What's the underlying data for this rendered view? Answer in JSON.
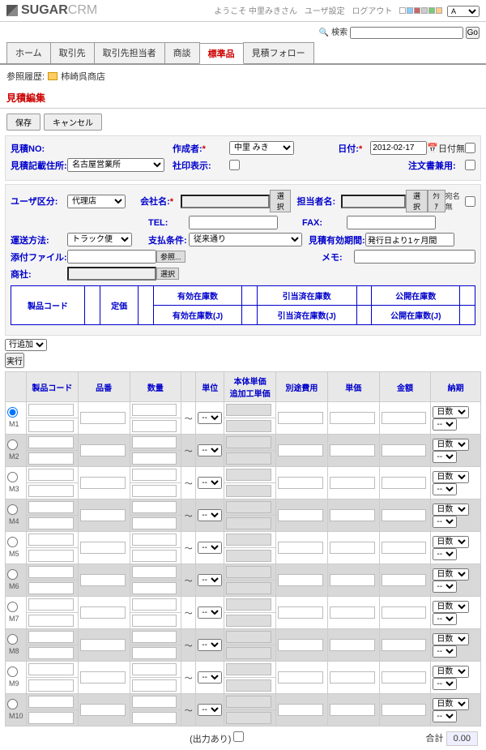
{
  "header": {
    "logo_main": "SUGAR",
    "logo_sub": "CRM",
    "welcome": "ようこそ 中里みきさん",
    "links": [
      "ユーザ設定",
      "ログアウト"
    ],
    "search_label": "検索",
    "search_btn": "Go"
  },
  "tabs": [
    "ホーム",
    "取引先",
    "取引先担当者",
    "商談",
    "標準品",
    "見積フォロー"
  ],
  "active_tab": "標準品",
  "breadcrumb": {
    "label": "参照履歴:",
    "item": "柿崎呉商店"
  },
  "page_title": "見積編集",
  "buttons": {
    "save": "保存",
    "cancel": "キャンセル"
  },
  "form": {
    "quote_no_lbl": "見積NO:",
    "address_lbl": "見積記載住所:",
    "address_val": "名古屋営業所",
    "creator_lbl": "作成者:",
    "creator_val": "中里 みき",
    "stamp_lbl": "社印表示:",
    "date_lbl": "日付:",
    "date_val": "2012-02-17",
    "date_none_lbl": "日付無",
    "order_lbl": "注文書兼用:",
    "user_div_lbl": "ユーザ区分:",
    "user_div_val": "代理店",
    "company_lbl": "会社名:",
    "select_btn": "選択",
    "clear_btn": "ｸﾘｱ",
    "anon_lbl": "宛名無",
    "contact_lbl": "担当者名:",
    "tel_lbl": "TEL:",
    "fax_lbl": "FAX:",
    "ship_lbl": "運送方法:",
    "ship_val": "トラック便",
    "pay_lbl": "支払条件:",
    "pay_val": "従来通り",
    "validity_lbl": "見積有効期間:",
    "validity_val": "発行日より1ヶ月間",
    "attach_lbl": "添付ファイル:",
    "attach_btn": "参照...",
    "memo_lbl": "メモ:",
    "trader_lbl": "商社:"
  },
  "stock": {
    "code": "製品コード",
    "price": "定価",
    "valid": "有効在庫数",
    "valid_j": "有効在庫数(J)",
    "alloc": "引当済在庫数",
    "alloc_j": "引当済在庫数(J)",
    "open": "公開在庫数",
    "open_j": "公開在庫数(J)"
  },
  "line_add": {
    "label": "行追加",
    "exec": "実行"
  },
  "grid_headers": {
    "code": "製品コード",
    "part": "品番",
    "qty": "数量",
    "unit": "単位",
    "unitprice": "本体単価\n追加工単価",
    "extra": "別途費用",
    "price": "単価",
    "amount": "金額",
    "due": "納期",
    "days": "日数"
  },
  "rows": [
    "M1",
    "M2",
    "M3",
    "M4",
    "M5",
    "M6",
    "M7",
    "M8",
    "M9",
    "M10"
  ],
  "footer": {
    "output_lbl": "(出力あり)",
    "total_lbl": "合計",
    "total_val": "0.00"
  }
}
